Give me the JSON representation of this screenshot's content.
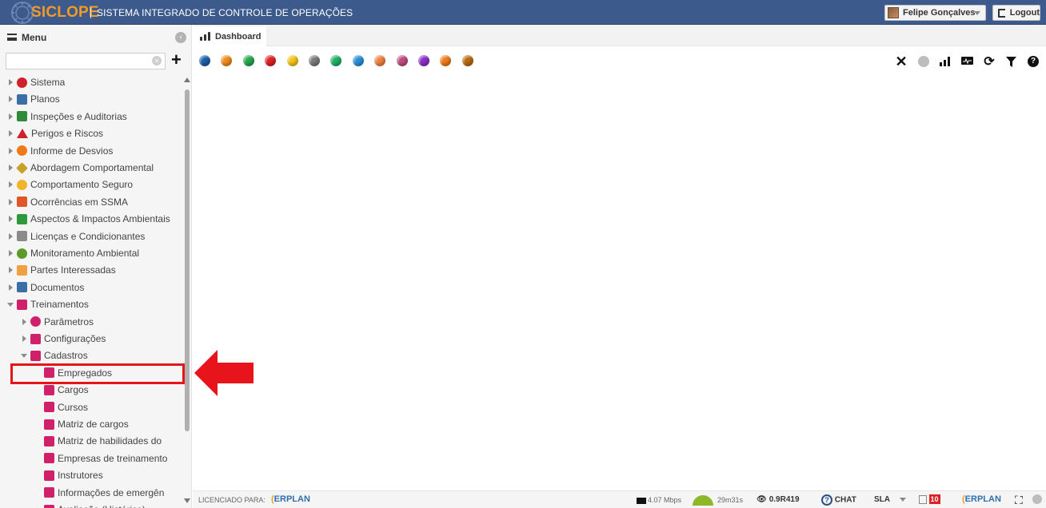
{
  "header": {
    "logo_text": "SICLOPE",
    "system_title": "SISTEMA INTEGRADO DE CONTROLE DE OPERAÇÕES",
    "user_name": "Felipe Gonçalves",
    "logout_label": "Logout",
    "bar_color": "#3c5b8c",
    "logo_color": "#f39a26"
  },
  "sidebar": {
    "menu_title": "Menu",
    "search": {
      "value": "",
      "placeholder": ""
    },
    "top_items": [
      {
        "label": "Sistema",
        "icon": "gear-icon",
        "color": "#d0202a"
      },
      {
        "label": "Planos",
        "icon": "plan-icon",
        "color": "#3a6ea5"
      },
      {
        "label": "Inspeções e Auditorias",
        "icon": "clipboard-check-icon",
        "color": "#2e8b3a"
      },
      {
        "label": "Perigos e Riscos",
        "icon": "warning-icon",
        "color": "#d0202a"
      },
      {
        "label": "Informe de Desvios",
        "icon": "chat-bubble-icon",
        "color": "#f07a1a"
      },
      {
        "label": "Abordagem Comportamental",
        "icon": "diamond-sign-icon",
        "color": "#c7a22a"
      },
      {
        "label": "Comportamento Seguro",
        "icon": "hard-hat-icon",
        "color": "#f0b428"
      },
      {
        "label": "Ocorrências em SSMA",
        "icon": "falling-person-icon",
        "color": "#e0572a"
      },
      {
        "label": "Aspectos & Impactos Ambientais",
        "icon": "recycle-icon",
        "color": "#2e9a3e"
      },
      {
        "label": "Licenças e Condicionantes",
        "icon": "certificate-icon",
        "color": "#8a8a8a"
      },
      {
        "label": "Monitoramento Ambiental",
        "icon": "tree-icon",
        "color": "#5c9a2a"
      },
      {
        "label": "Partes Interessadas",
        "icon": "people-icon",
        "color": "#f0a040"
      },
      {
        "label": "Documentos",
        "icon": "document-icon",
        "color": "#3a6ea5"
      },
      {
        "label": "Treinamentos",
        "icon": "folder-open-icon",
        "color": "#d0206a"
      }
    ],
    "treinamentos_children": [
      {
        "label": "Parâmetros",
        "icon": "gear-icon",
        "color": "#d0206a"
      },
      {
        "label": "Configurações",
        "icon": "sliders-icon",
        "color": "#d0206a"
      },
      {
        "label": "Cadastros",
        "icon": "folder-open-icon",
        "color": "#d0206a"
      }
    ],
    "cadastros_children": [
      {
        "label": "Empregados",
        "icon": "employees-icon",
        "color": "#d0206a"
      },
      {
        "label": "Cargos",
        "icon": "briefcase-icon",
        "color": "#d0206a"
      },
      {
        "label": "Cursos",
        "icon": "course-icon",
        "color": "#d0206a"
      },
      {
        "label": "Matriz de cargos",
        "icon": "grid-icon",
        "color": "#d0206a"
      },
      {
        "label": "Matriz de habilidades do",
        "icon": "grid-icon",
        "color": "#d0206a"
      },
      {
        "label": "Empresas de treinamento",
        "icon": "building-icon",
        "color": "#d0206a"
      },
      {
        "label": "Instrutores",
        "icon": "instructor-icon",
        "color": "#d0206a"
      },
      {
        "label": "Informações de emergên",
        "icon": "falling-person-icon",
        "color": "#d0206a"
      },
      {
        "label": "Avaliação (Histórico)",
        "icon": "chart-icon",
        "color": "#d0206a"
      }
    ]
  },
  "main": {
    "tab_label": "Dashboard",
    "status_dots": [
      "#1f5fa8",
      "#f08a1c",
      "#22a84a",
      "#e02020",
      "#f5c41a",
      "#7a7a7a",
      "#1fb060",
      "#2a8fd8",
      "#f08040",
      "#c04a80",
      "#8a30c8",
      "#f07a1a",
      "#b86a10"
    ],
    "toolbar_icons": [
      "close-icon",
      "circle-icon",
      "signal-bars-icon",
      "monitor-icon",
      "refresh-icon",
      "filter-icon",
      "help-icon"
    ]
  },
  "statusbar": {
    "licensed_label": "LICENCIADO PARA:",
    "licensee_brand": "ERPLAN",
    "speed": "4.07 Mbps",
    "session_time": "29m31s",
    "version": "0.9R419",
    "chat_label": "CHAT",
    "sla_label": "SLA",
    "notification_count": "10",
    "footer_brand": "ERPLAN"
  },
  "annotation": {
    "color": "#e8141b"
  }
}
